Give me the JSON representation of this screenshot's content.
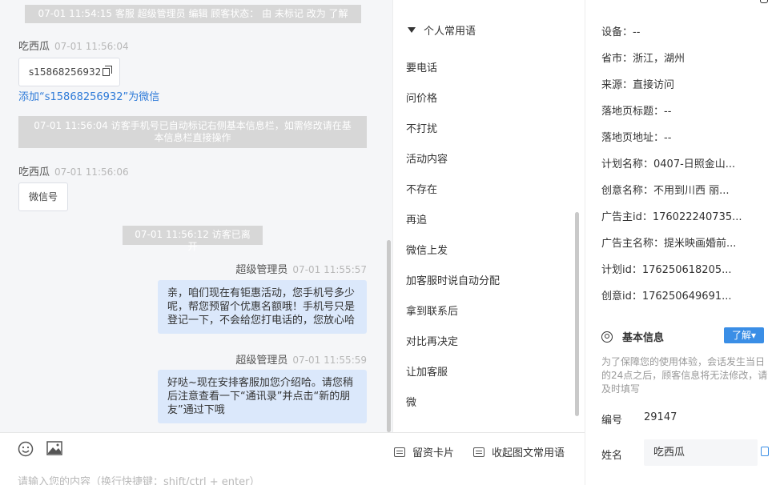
{
  "chat": {
    "sys1": "07-01 11:54:15 客服 超级管理员 编辑 顾客状态： 由 未标记 改为 了解",
    "msg1": {
      "sender": "吃西瓜",
      "time": "07-01 11:56:04",
      "card": "s15868256932"
    },
    "add_wechat": "添加“s15868256932”为微信",
    "sys2_line1": "07-01 11:56:04 访客手机号已自动标记右侧基本信息栏，如需修改请在基",
    "sys2_line2": "本信息栏直接操作",
    "msg2": {
      "sender": "吃西瓜",
      "time": "07-01 11:56:06",
      "card": "微信号"
    },
    "sys3": "07-01 11:56:12 访客已离开",
    "reply1": {
      "sender": "超级管理员",
      "time": "07-01 11:55:57",
      "line1": "亲，咱们现在有钜惠活动，您手机号多少",
      "line2": "呢，帮您预留个优惠名额哦！手机号只是",
      "line3": "登记一下，不会给您打电话的，您放心哈"
    },
    "reply2": {
      "sender": "超级管理员",
      "time": "07-01 11:55:59",
      "line1": "好哒~现在安排客服加您介绍哈。请您稍",
      "line2": "后注意查看一下“通讯录”并点击“新的朋",
      "line3": "友”通过下哦"
    }
  },
  "input": {
    "placeholder": "请输入您的内容（换行快捷键：shift/ctrl + enter）",
    "card_btn": "留资卡片",
    "collect_btn": "收起图文常用语"
  },
  "phrases": {
    "header": "个人常用语",
    "items": [
      "要电话",
      "问价格",
      "不打扰",
      "活动内容",
      "不存在",
      "再追",
      "微信上发",
      "加客服时说自动分配",
      "拿到联系后",
      "对比再决定",
      "让加客服",
      "微"
    ]
  },
  "info": {
    "source_rows": [
      "设备：--",
      "省市：浙江，湖州",
      "来源：直接访问",
      "落地页标题：--",
      "落地页地址：--",
      "计划名称：0407-日照金山...",
      "创意名称：不用到川西 丽...",
      "广告主id：176022240735...",
      "广告主名称：提米映画婚前...",
      "计划id：176250618205...",
      "创意id：176250649691..."
    ],
    "basic_title": "基本信息",
    "learn_label": "了解▾",
    "notice": "为了保障您的使用体验，会话发生当日的24点之后，顾客信息将无法修改，请及时填写",
    "id_label": "编号",
    "id_value": "29147",
    "name_label": "姓名",
    "name_value": "吃西瓜"
  }
}
